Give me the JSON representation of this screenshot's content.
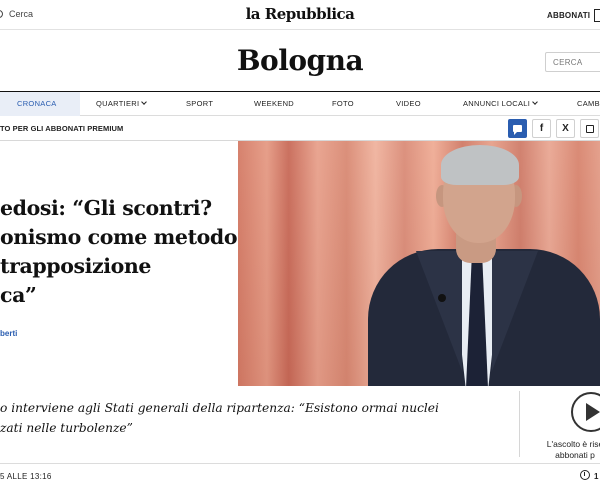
{
  "topbar": {
    "search_label": "Cerca",
    "logo": "la Repubblica",
    "subscribe_label": "ABBONATI"
  },
  "section": {
    "title": "Bologna",
    "search_placeholder": "CERCA"
  },
  "nav": {
    "items": [
      {
        "label": "CRONACA",
        "active": true
      },
      {
        "label": "QUARTIERI",
        "dropdown": true
      },
      {
        "label": "SPORT"
      },
      {
        "label": "WEEKEND"
      },
      {
        "label": "FOTO"
      },
      {
        "label": "VIDEO"
      },
      {
        "label": "ANNUNCI LOCALI",
        "dropdown": true
      },
      {
        "label": "CAMBI"
      }
    ],
    "accent_color": "#2a5db0"
  },
  "subheader": {
    "premium_label": "TO PER GLI ABBONATI PREMIUM",
    "share": [
      {
        "icon": "comment-icon"
      },
      {
        "icon": "facebook-icon",
        "glyph": "f"
      },
      {
        "icon": "x-twitter-icon",
        "glyph": "X"
      },
      {
        "icon": "share-icon"
      }
    ]
  },
  "article": {
    "headline_lines": [
      "edosi: “Gli scontri?",
      "onismo come metodo",
      "trapposizione",
      "ca”"
    ],
    "author": "berti",
    "summary_lines": [
      "o interviene agli Stati generali della ripartenza: “Esistono ormai nuclei",
      "zati nelle turbolenze”"
    ],
    "date": "5 ALLE 13:16",
    "read_time": "1 M"
  },
  "audio": {
    "note_line1": "L'ascolto è rise",
    "note_line2": "abbonati p"
  }
}
